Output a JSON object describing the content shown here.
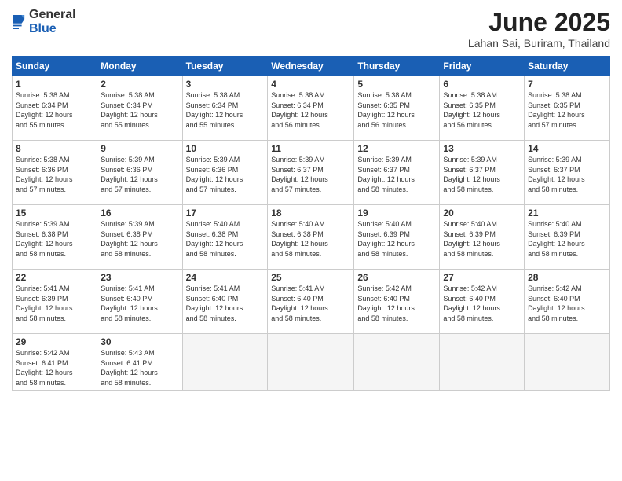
{
  "header": {
    "logo_general": "General",
    "logo_blue": "Blue",
    "month_title": "June 2025",
    "location": "Lahan Sai, Buriram, Thailand"
  },
  "weekdays": [
    "Sunday",
    "Monday",
    "Tuesday",
    "Wednesday",
    "Thursday",
    "Friday",
    "Saturday"
  ],
  "weeks": [
    [
      {
        "day": "1",
        "info": "Sunrise: 5:38 AM\nSunset: 6:34 PM\nDaylight: 12 hours\nand 55 minutes."
      },
      {
        "day": "2",
        "info": "Sunrise: 5:38 AM\nSunset: 6:34 PM\nDaylight: 12 hours\nand 55 minutes."
      },
      {
        "day": "3",
        "info": "Sunrise: 5:38 AM\nSunset: 6:34 PM\nDaylight: 12 hours\nand 55 minutes."
      },
      {
        "day": "4",
        "info": "Sunrise: 5:38 AM\nSunset: 6:34 PM\nDaylight: 12 hours\nand 56 minutes."
      },
      {
        "day": "5",
        "info": "Sunrise: 5:38 AM\nSunset: 6:35 PM\nDaylight: 12 hours\nand 56 minutes."
      },
      {
        "day": "6",
        "info": "Sunrise: 5:38 AM\nSunset: 6:35 PM\nDaylight: 12 hours\nand 56 minutes."
      },
      {
        "day": "7",
        "info": "Sunrise: 5:38 AM\nSunset: 6:35 PM\nDaylight: 12 hours\nand 57 minutes."
      }
    ],
    [
      {
        "day": "8",
        "info": "Sunrise: 5:38 AM\nSunset: 6:36 PM\nDaylight: 12 hours\nand 57 minutes."
      },
      {
        "day": "9",
        "info": "Sunrise: 5:39 AM\nSunset: 6:36 PM\nDaylight: 12 hours\nand 57 minutes."
      },
      {
        "day": "10",
        "info": "Sunrise: 5:39 AM\nSunset: 6:36 PM\nDaylight: 12 hours\nand 57 minutes."
      },
      {
        "day": "11",
        "info": "Sunrise: 5:39 AM\nSunset: 6:37 PM\nDaylight: 12 hours\nand 57 minutes."
      },
      {
        "day": "12",
        "info": "Sunrise: 5:39 AM\nSunset: 6:37 PM\nDaylight: 12 hours\nand 58 minutes."
      },
      {
        "day": "13",
        "info": "Sunrise: 5:39 AM\nSunset: 6:37 PM\nDaylight: 12 hours\nand 58 minutes."
      },
      {
        "day": "14",
        "info": "Sunrise: 5:39 AM\nSunset: 6:37 PM\nDaylight: 12 hours\nand 58 minutes."
      }
    ],
    [
      {
        "day": "15",
        "info": "Sunrise: 5:39 AM\nSunset: 6:38 PM\nDaylight: 12 hours\nand 58 minutes."
      },
      {
        "day": "16",
        "info": "Sunrise: 5:39 AM\nSunset: 6:38 PM\nDaylight: 12 hours\nand 58 minutes."
      },
      {
        "day": "17",
        "info": "Sunrise: 5:40 AM\nSunset: 6:38 PM\nDaylight: 12 hours\nand 58 minutes."
      },
      {
        "day": "18",
        "info": "Sunrise: 5:40 AM\nSunset: 6:38 PM\nDaylight: 12 hours\nand 58 minutes."
      },
      {
        "day": "19",
        "info": "Sunrise: 5:40 AM\nSunset: 6:39 PM\nDaylight: 12 hours\nand 58 minutes."
      },
      {
        "day": "20",
        "info": "Sunrise: 5:40 AM\nSunset: 6:39 PM\nDaylight: 12 hours\nand 58 minutes."
      },
      {
        "day": "21",
        "info": "Sunrise: 5:40 AM\nSunset: 6:39 PM\nDaylight: 12 hours\nand 58 minutes."
      }
    ],
    [
      {
        "day": "22",
        "info": "Sunrise: 5:41 AM\nSunset: 6:39 PM\nDaylight: 12 hours\nand 58 minutes."
      },
      {
        "day": "23",
        "info": "Sunrise: 5:41 AM\nSunset: 6:40 PM\nDaylight: 12 hours\nand 58 minutes."
      },
      {
        "day": "24",
        "info": "Sunrise: 5:41 AM\nSunset: 6:40 PM\nDaylight: 12 hours\nand 58 minutes."
      },
      {
        "day": "25",
        "info": "Sunrise: 5:41 AM\nSunset: 6:40 PM\nDaylight: 12 hours\nand 58 minutes."
      },
      {
        "day": "26",
        "info": "Sunrise: 5:42 AM\nSunset: 6:40 PM\nDaylight: 12 hours\nand 58 minutes."
      },
      {
        "day": "27",
        "info": "Sunrise: 5:42 AM\nSunset: 6:40 PM\nDaylight: 12 hours\nand 58 minutes."
      },
      {
        "day": "28",
        "info": "Sunrise: 5:42 AM\nSunset: 6:40 PM\nDaylight: 12 hours\nand 58 minutes."
      }
    ],
    [
      {
        "day": "29",
        "info": "Sunrise: 5:42 AM\nSunset: 6:41 PM\nDaylight: 12 hours\nand 58 minutes."
      },
      {
        "day": "30",
        "info": "Sunrise: 5:43 AM\nSunset: 6:41 PM\nDaylight: 12 hours\nand 58 minutes."
      },
      null,
      null,
      null,
      null,
      null
    ]
  ]
}
